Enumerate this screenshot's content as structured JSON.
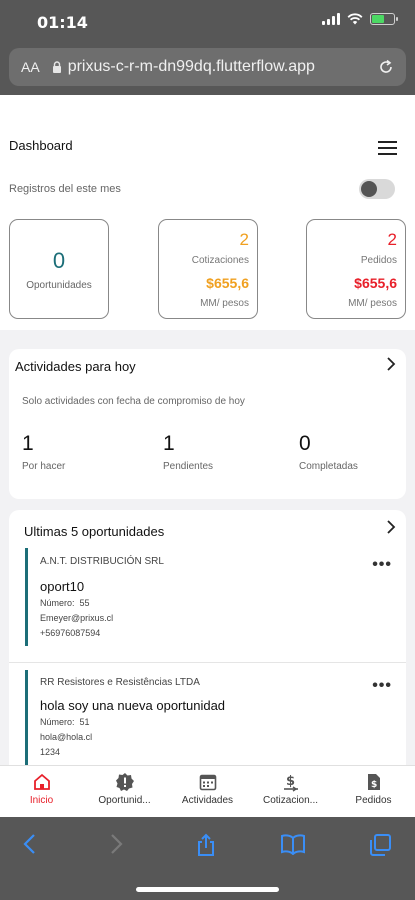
{
  "status_bar": {
    "time": "01:14"
  },
  "browser": {
    "aa_label": "AA",
    "url": "prixus-c-r-m-dn99dq.flutterflow.app"
  },
  "header": {
    "title": "Dashboard",
    "filter_label": "Registros del este mes",
    "toggle_on": false
  },
  "cards": {
    "oportunidades": {
      "value": "0",
      "label": "Oportunidades"
    },
    "cotizaciones": {
      "count": "2",
      "label": "Cotizaciones",
      "amount": "$655,6",
      "unit": "MM/ pesos",
      "color": "#f0a020"
    },
    "pedidos": {
      "count": "2",
      "label": "Pedidos",
      "amount": "$655,6",
      "unit": "MM/ pesos",
      "color": "#e8202a"
    }
  },
  "activities": {
    "title": "Actividades para hoy",
    "subtitle": "Solo actividades con fecha de compromiso de hoy",
    "stats": [
      {
        "value": "1",
        "label": "Por hacer"
      },
      {
        "value": "1",
        "label": "Pendientes"
      },
      {
        "value": "0",
        "label": "Completadas"
      }
    ]
  },
  "opportunities": {
    "title": "Ultimas 5 oportunidades",
    "items": [
      {
        "company": "A.N.T. DISTRIBUCIÓN SRL",
        "name": "oport10",
        "number_label": "Número:",
        "number": "55",
        "email": "Emeyer@prixus.cl",
        "phone": "+56976087594"
      },
      {
        "company": "RR Resistores e Resistências LTDA",
        "name": "hola soy una nueva oportunidad",
        "number_label": "Número:",
        "number": "51",
        "email": "hola@hola.cl",
        "phone": "1234"
      }
    ]
  },
  "nav": [
    {
      "label": "Inicio",
      "icon": "home-icon",
      "active": true
    },
    {
      "label": "Oportunid...",
      "icon": "alert-badge-icon",
      "active": false
    },
    {
      "label": "Actividades",
      "icon": "calendar-icon",
      "active": false
    },
    {
      "label": "Cotizacion...",
      "icon": "dollar-icon",
      "active": false
    },
    {
      "label": "Pedidos",
      "icon": "invoice-icon",
      "active": false
    }
  ],
  "colors": {
    "accent": "#1c6e78",
    "active_nav": "#e8202a",
    "ios_blue": "#3a8ef6"
  }
}
